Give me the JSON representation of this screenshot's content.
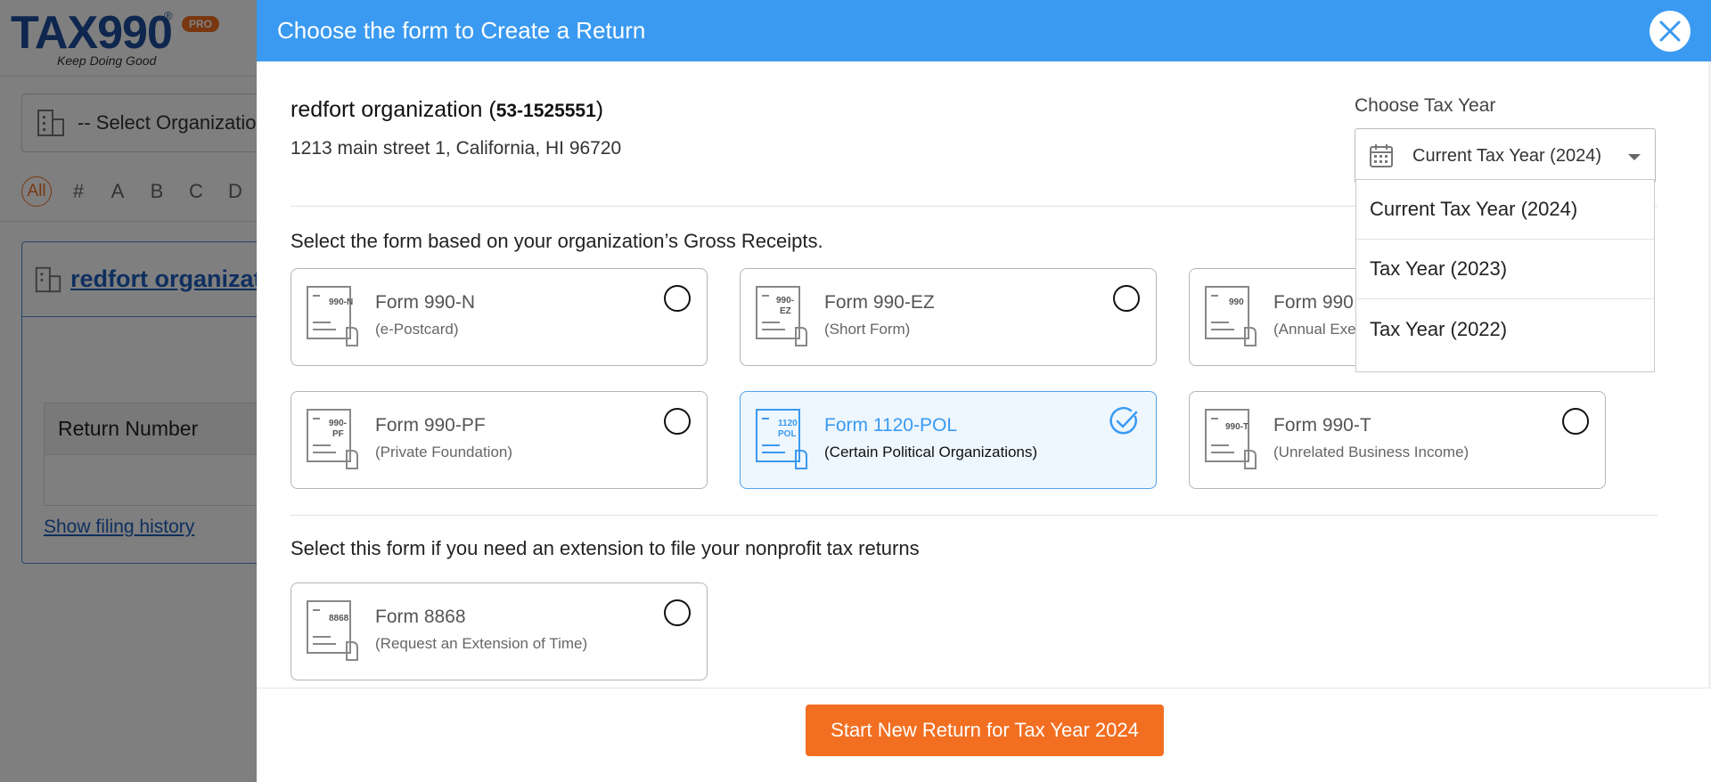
{
  "app": {
    "logo_text": "TAX990",
    "logo_badge": "PRO",
    "logo_tagline": "Keep Doing Good",
    "org_select_placeholder": "-- Select Organizatio..",
    "alpha_filter": [
      "All",
      "#",
      "A",
      "B",
      "C",
      "D"
    ],
    "org_card": {
      "name": "redfort organizati",
      "table_header": "Return Number",
      "show_history": "Show filing history"
    }
  },
  "modal": {
    "title": "Choose the form to Create a Return",
    "organization": {
      "name": "redfort organization",
      "ein": "53-1525551",
      "address": "1213 main street 1, California, HI 96720"
    },
    "tax_year": {
      "label": "Choose Tax Year",
      "selected": "Current Tax Year (2024)",
      "options": [
        "Current Tax Year (2024)",
        "Tax Year (2023)",
        "Tax Year (2022)"
      ]
    },
    "gross_receipts_title": "Select the form based on your organization’s Gross Receipts.",
    "forms": [
      {
        "icon_label": "990-N",
        "name": "Form 990-N",
        "sub": "(e-Postcard)",
        "selected": false
      },
      {
        "icon_label": "990-EZ",
        "name": "Form 990-EZ",
        "sub": "(Short Form)",
        "selected": false
      },
      {
        "icon_label": "990",
        "name": "Form 990",
        "sub": "(Annual Exe",
        "selected": false
      },
      {
        "icon_label": "990-PF",
        "name": "Form 990-PF",
        "sub": "(Private Foundation)",
        "selected": false
      },
      {
        "icon_label": "1120 POL",
        "name": "Form 1120-POL",
        "sub": "(Certain Political Organizations)",
        "selected": true
      },
      {
        "icon_label": "990-T",
        "name": "Form 990-T",
        "sub": "(Unrelated Business Income)",
        "selected": false
      }
    ],
    "extension_title": "Select this form if you need an extension to file your nonprofit tax returns",
    "extension_form": {
      "icon_label": "8868",
      "name": "Form 8868",
      "sub": "(Request an Extension of Time)",
      "selected": false
    },
    "start_button": "Start New Return for Tax Year 2024"
  },
  "colors": {
    "header_blue": "#3a9af1",
    "accent_orange": "#f26f21",
    "selected_bg": "#eef6fe"
  }
}
